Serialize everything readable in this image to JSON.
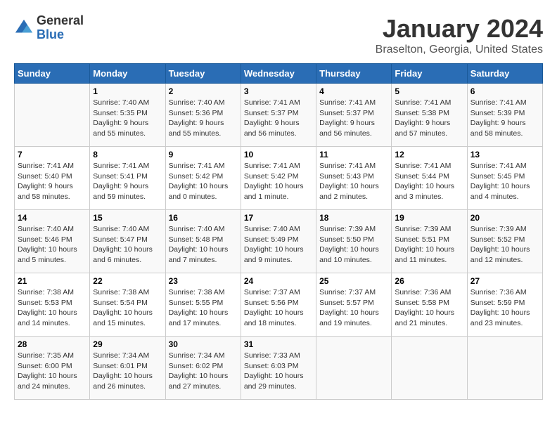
{
  "header": {
    "logo_general": "General",
    "logo_blue": "Blue",
    "title": "January 2024",
    "subtitle": "Braselton, Georgia, United States"
  },
  "days_of_week": [
    "Sunday",
    "Monday",
    "Tuesday",
    "Wednesday",
    "Thursday",
    "Friday",
    "Saturday"
  ],
  "weeks": [
    [
      {
        "day": "",
        "info": ""
      },
      {
        "day": "1",
        "info": "Sunrise: 7:40 AM\nSunset: 5:35 PM\nDaylight: 9 hours\nand 55 minutes."
      },
      {
        "day": "2",
        "info": "Sunrise: 7:40 AM\nSunset: 5:36 PM\nDaylight: 9 hours\nand 55 minutes."
      },
      {
        "day": "3",
        "info": "Sunrise: 7:41 AM\nSunset: 5:37 PM\nDaylight: 9 hours\nand 56 minutes."
      },
      {
        "day": "4",
        "info": "Sunrise: 7:41 AM\nSunset: 5:37 PM\nDaylight: 9 hours\nand 56 minutes."
      },
      {
        "day": "5",
        "info": "Sunrise: 7:41 AM\nSunset: 5:38 PM\nDaylight: 9 hours\nand 57 minutes."
      },
      {
        "day": "6",
        "info": "Sunrise: 7:41 AM\nSunset: 5:39 PM\nDaylight: 9 hours\nand 58 minutes."
      }
    ],
    [
      {
        "day": "7",
        "info": "Sunrise: 7:41 AM\nSunset: 5:40 PM\nDaylight: 9 hours\nand 58 minutes."
      },
      {
        "day": "8",
        "info": "Sunrise: 7:41 AM\nSunset: 5:41 PM\nDaylight: 9 hours\nand 59 minutes."
      },
      {
        "day": "9",
        "info": "Sunrise: 7:41 AM\nSunset: 5:42 PM\nDaylight: 10 hours\nand 0 minutes."
      },
      {
        "day": "10",
        "info": "Sunrise: 7:41 AM\nSunset: 5:42 PM\nDaylight: 10 hours\nand 1 minute."
      },
      {
        "day": "11",
        "info": "Sunrise: 7:41 AM\nSunset: 5:43 PM\nDaylight: 10 hours\nand 2 minutes."
      },
      {
        "day": "12",
        "info": "Sunrise: 7:41 AM\nSunset: 5:44 PM\nDaylight: 10 hours\nand 3 minutes."
      },
      {
        "day": "13",
        "info": "Sunrise: 7:41 AM\nSunset: 5:45 PM\nDaylight: 10 hours\nand 4 minutes."
      }
    ],
    [
      {
        "day": "14",
        "info": "Sunrise: 7:40 AM\nSunset: 5:46 PM\nDaylight: 10 hours\nand 5 minutes."
      },
      {
        "day": "15",
        "info": "Sunrise: 7:40 AM\nSunset: 5:47 PM\nDaylight: 10 hours\nand 6 minutes."
      },
      {
        "day": "16",
        "info": "Sunrise: 7:40 AM\nSunset: 5:48 PM\nDaylight: 10 hours\nand 7 minutes."
      },
      {
        "day": "17",
        "info": "Sunrise: 7:40 AM\nSunset: 5:49 PM\nDaylight: 10 hours\nand 9 minutes."
      },
      {
        "day": "18",
        "info": "Sunrise: 7:39 AM\nSunset: 5:50 PM\nDaylight: 10 hours\nand 10 minutes."
      },
      {
        "day": "19",
        "info": "Sunrise: 7:39 AM\nSunset: 5:51 PM\nDaylight: 10 hours\nand 11 minutes."
      },
      {
        "day": "20",
        "info": "Sunrise: 7:39 AM\nSunset: 5:52 PM\nDaylight: 10 hours\nand 12 minutes."
      }
    ],
    [
      {
        "day": "21",
        "info": "Sunrise: 7:38 AM\nSunset: 5:53 PM\nDaylight: 10 hours\nand 14 minutes."
      },
      {
        "day": "22",
        "info": "Sunrise: 7:38 AM\nSunset: 5:54 PM\nDaylight: 10 hours\nand 15 minutes."
      },
      {
        "day": "23",
        "info": "Sunrise: 7:38 AM\nSunset: 5:55 PM\nDaylight: 10 hours\nand 17 minutes."
      },
      {
        "day": "24",
        "info": "Sunrise: 7:37 AM\nSunset: 5:56 PM\nDaylight: 10 hours\nand 18 minutes."
      },
      {
        "day": "25",
        "info": "Sunrise: 7:37 AM\nSunset: 5:57 PM\nDaylight: 10 hours\nand 19 minutes."
      },
      {
        "day": "26",
        "info": "Sunrise: 7:36 AM\nSunset: 5:58 PM\nDaylight: 10 hours\nand 21 minutes."
      },
      {
        "day": "27",
        "info": "Sunrise: 7:36 AM\nSunset: 5:59 PM\nDaylight: 10 hours\nand 23 minutes."
      }
    ],
    [
      {
        "day": "28",
        "info": "Sunrise: 7:35 AM\nSunset: 6:00 PM\nDaylight: 10 hours\nand 24 minutes."
      },
      {
        "day": "29",
        "info": "Sunrise: 7:34 AM\nSunset: 6:01 PM\nDaylight: 10 hours\nand 26 minutes."
      },
      {
        "day": "30",
        "info": "Sunrise: 7:34 AM\nSunset: 6:02 PM\nDaylight: 10 hours\nand 27 minutes."
      },
      {
        "day": "31",
        "info": "Sunrise: 7:33 AM\nSunset: 6:03 PM\nDaylight: 10 hours\nand 29 minutes."
      },
      {
        "day": "",
        "info": ""
      },
      {
        "day": "",
        "info": ""
      },
      {
        "day": "",
        "info": ""
      }
    ]
  ]
}
